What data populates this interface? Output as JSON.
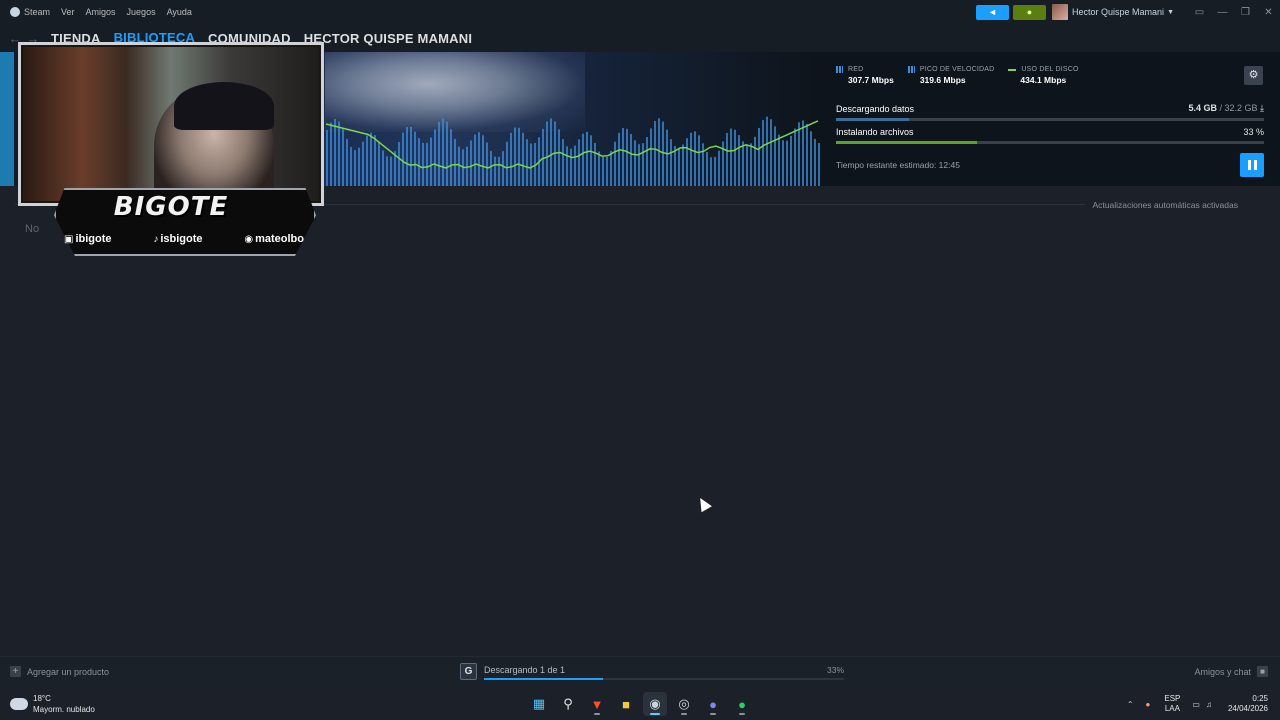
{
  "menubar": {
    "items": [
      "Steam",
      "Ver",
      "Amigos",
      "Juegos",
      "Ayuda"
    ],
    "user_name": "Hector Quispe Mamani"
  },
  "nav": {
    "links": [
      "TIENDA",
      "BIBLIOTECA",
      "COMUNIDAD",
      "HECTOR QUISPE MAMANI"
    ],
    "active": "BIBLIOTECA"
  },
  "downloads": {
    "stats": [
      {
        "label": "RED",
        "value": "307.7 Mbps"
      },
      {
        "label": "PICO DE VELOCIDAD",
        "value": "319.6 Mbps"
      },
      {
        "label": "USO DEL DISCO",
        "value": "434.1 Mbps"
      }
    ],
    "downloading_label": "Descargando datos",
    "downloaded": "5.4 GB",
    "total": "/ 32.2 GB",
    "download_progress": 0.17,
    "installing_label": "Instalando archivos",
    "install_percent": "33 %",
    "install_progress": 0.33,
    "eta": "Tiempo restante estimado: 12:45",
    "auto_updates": "Actualizaciones automáticas activadas",
    "no_text": "No"
  },
  "webcam": {
    "brand": "BIGOTE",
    "socials": [
      "ibigote",
      "isbigote",
      "mateolbo"
    ]
  },
  "bottom_bar": {
    "add_product": "Agregar un producto",
    "download_status": "Descargando 1 de 1",
    "download_percent": "33%",
    "download_progress": 0.33,
    "friends_chat": "Amigos y chat"
  },
  "taskbar": {
    "temperature": "18°C",
    "weather": "Mayorm. nublado",
    "lang_1": "ESP",
    "lang_2": "LAA",
    "time": "0:25",
    "date": "24/04/2026"
  },
  "colors": {
    "accent": "#1a9fff",
    "install_bar": "#5ba32b",
    "disk_line": "#7ad84a",
    "net_bars": "#3d8fdc"
  }
}
